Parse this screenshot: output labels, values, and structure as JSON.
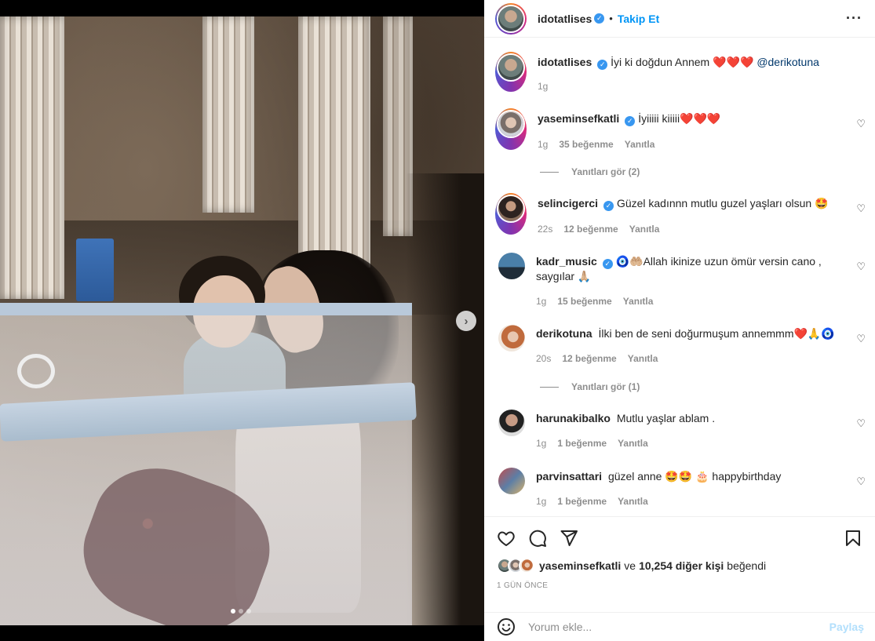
{
  "post": {
    "author": "idotatlises",
    "follow_label": "Takip Et",
    "more_icon": "more-horizontal-icon",
    "separator": "•"
  },
  "caption": {
    "username": "idotatlises",
    "text": "İyi ki doğdun Annem",
    "hearts": "❤️❤️❤️",
    "mention": "@derikotuna",
    "time": "1g"
  },
  "comments": [
    {
      "username": "yaseminsefkatli",
      "verified": true,
      "text": "İyiiiii kiiiii❤️❤️❤️",
      "time": "1g",
      "likes": "35 beğenme",
      "reply": "Yanıtla",
      "view_replies": "Yanıtları gör (2)"
    },
    {
      "username": "selincigerci",
      "verified": true,
      "text": "Güzel kadınnn mutlu guzel yaşları olsun 🤩",
      "time": "22s",
      "likes": "12 beğenme",
      "reply": "Yanıtla"
    },
    {
      "username": "kadr_music",
      "verified": true,
      "text": "🧿🤲🏼Allah ikinize uzun ömür versin cano , saygılar 🙏🏼",
      "time": "1g",
      "likes": "15 beğenme",
      "reply": "Yanıtla"
    },
    {
      "username": "derikotuna",
      "verified": false,
      "text": "İlki ben de seni doğurmuşum annemmm❤️🙏🧿",
      "time": "20s",
      "likes": "12 beğenme",
      "reply": "Yanıtla",
      "view_replies": "Yanıtları gör (1)"
    },
    {
      "username": "harunakibalko",
      "verified": false,
      "text": "Mutlu yaşlar ablam .",
      "time": "1g",
      "likes": "1 beğenme",
      "reply": "Yanıtla"
    },
    {
      "username": "parvinsattari",
      "verified": false,
      "text": "güzel anne 🤩🤩 🎂 happybirthday",
      "time": "1g",
      "likes": "1 beğenme",
      "reply": "Yanıtla"
    }
  ],
  "likes_summary": {
    "first_user": "yaseminsefkatli",
    "connector": "ve",
    "count_text": "10,254 diğer kişi",
    "suffix": "beğendi"
  },
  "timestamp": "1 GÜN ÖNCE",
  "add_comment": {
    "placeholder": "Yorum ekle...",
    "post_label": "Paylaş"
  },
  "carousel": {
    "current": 1,
    "total": 3
  },
  "colors": {
    "accent": "#0095f6",
    "verified": "#3897f0",
    "heart": "#e0162b",
    "post_disabled": "#b2dffc"
  }
}
